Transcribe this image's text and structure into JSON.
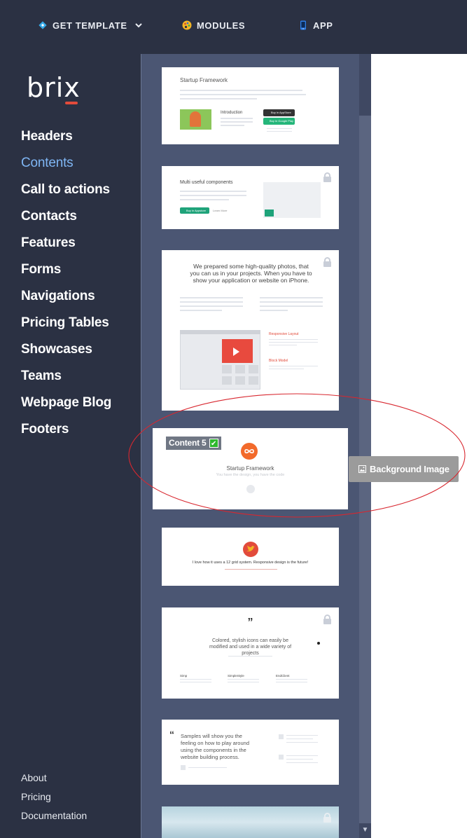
{
  "topnav": {
    "items": [
      {
        "label": "GET TEMPLATE",
        "icon": "diamond-icon"
      },
      {
        "label": "MODULES",
        "icon": "palette-icon"
      },
      {
        "label": "APP",
        "icon": "phone-icon"
      }
    ]
  },
  "logo": {
    "text": "brix"
  },
  "sidebar": {
    "items": [
      {
        "label": "Headers"
      },
      {
        "label": "Contents",
        "active": true
      },
      {
        "label": "Call to actions"
      },
      {
        "label": "Contacts"
      },
      {
        "label": "Features"
      },
      {
        "label": "Forms"
      },
      {
        "label": "Navigations"
      },
      {
        "label": "Pricing Tables"
      },
      {
        "label": "Showcases"
      },
      {
        "label": "Teams"
      },
      {
        "label": "Webpage Blog"
      },
      {
        "label": "Footers"
      }
    ],
    "footer": [
      {
        "label": "About"
      },
      {
        "label": "Pricing"
      },
      {
        "label": "Documentation"
      }
    ]
  },
  "cards": {
    "c1": {
      "title": "Startup Framework",
      "subtitle": "Introduction",
      "btn1": "Buy in AppStore",
      "btn2": "Buy in Google Play"
    },
    "c2": {
      "title": "Multi useful components",
      "btn": "Buy in Appstore",
      "link": "Learn More"
    },
    "c3": {
      "title": "We prepared some high-quality photos, that you can us in your projects. When you have to show your application or website on iPhone.",
      "feat1": "Responsive Layout",
      "feat2": "Block Model"
    },
    "c4": {
      "title": "Startup Framework",
      "subtitle": "You have the design, you have the code"
    },
    "c5": {
      "quote": "I love how it uses a 12 grid system. Responsive design is the future!"
    },
    "c6": {
      "mark": "”",
      "quote": "Colored, stylish icons can easily be modified and used in a wide variety of projects",
      "col1": "Simp",
      "col2": "SimpleStyle",
      "col3": "EndClient"
    },
    "c7": {
      "mark": "“",
      "quote": "Samples will show you the feeling on how to play around using the components in the website building process."
    }
  },
  "selected": {
    "label": "Content 5",
    "check": "✔"
  },
  "background_button": {
    "label": "Background Image",
    "icon": "image-icon"
  },
  "colors": {
    "sidebar": "#2b3143",
    "panel": "#4b5673",
    "active_nav": "#7fb6f4",
    "accent": "#e24b3b",
    "green": "#1fa37a",
    "annotation": "#d8272f"
  }
}
